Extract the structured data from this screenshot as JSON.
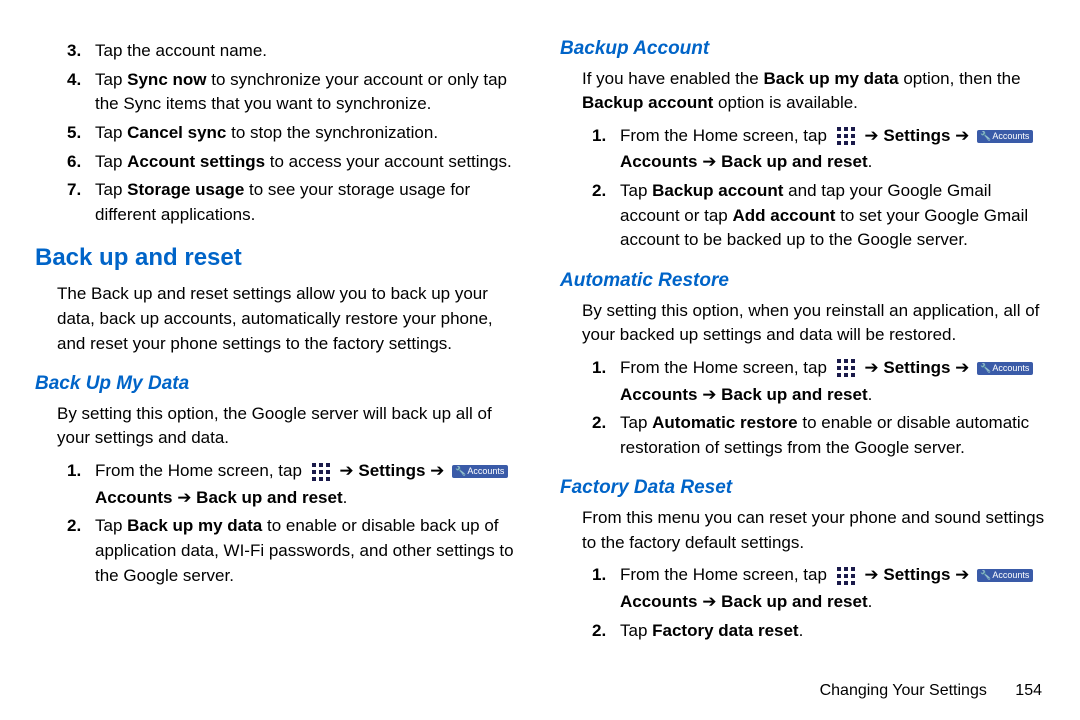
{
  "left": {
    "steps_top": [
      {
        "n": "3.",
        "text": "Tap the account name."
      },
      {
        "n": "4.",
        "html": "Tap <b>Sync now</b> to synchronize your account or only tap the Sync items that you want to synchronize."
      },
      {
        "n": "5.",
        "html": "Tap <b>Cancel sync</b> to stop the synchronization."
      },
      {
        "n": "6.",
        "html": "Tap <b>Account settings</b> to access your account settings."
      },
      {
        "n": "7.",
        "html": "Tap <b>Storage usage</b> to see your storage usage for different applications."
      }
    ],
    "section_backup": "Back up and reset",
    "section_backup_body": "The Back up and reset settings allow you to back up your data, back up accounts, automatically restore your phone, and reset your phone settings to the factory settings.",
    "sub_backupmydata": "Back Up My Data",
    "sub_backupmydata_body": "By setting this option, the Google server will back up all of your settings and data.",
    "path_home_prefix": "From the Home screen, tap",
    "path_settings": "Settings",
    "path_accounts": "Accounts",
    "path_backupreset": "Back up and reset",
    "step_backupdata_2": "Tap <b>Back up my data</b> to enable or disable back up of application data, WI-Fi passwords, and other settings to the Google server."
  },
  "right": {
    "sub_backupaccount": "Backup Account",
    "sub_backupaccount_body": "If you have enabled the <b>Back up my data</b> option, then the <b>Backup account</b> option is available.",
    "step_ba_2": "Tap <b>Backup account</b> and tap your Google Gmail account or tap <b>Add account</b> to set your Google Gmail account to be backed up to the Google server.",
    "sub_autorestore": "Automatic Restore",
    "sub_autorestore_body": "By setting this option, when you reinstall an application, all of your backed up settings and data will be restored.",
    "step_ar_2": "Tap <b>Automatic restore</b> to enable or disable automatic restoration of settings from the Google server.",
    "sub_factory": "Factory Data Reset",
    "sub_factory_body": "From this menu you can reset your phone and sound settings to the factory default settings.",
    "step_fr_2": "Tap <b>Factory data reset</b>."
  },
  "icons": {
    "accounts_label": "Accounts"
  },
  "footer": {
    "section": "Changing Your Settings",
    "page": "154"
  }
}
